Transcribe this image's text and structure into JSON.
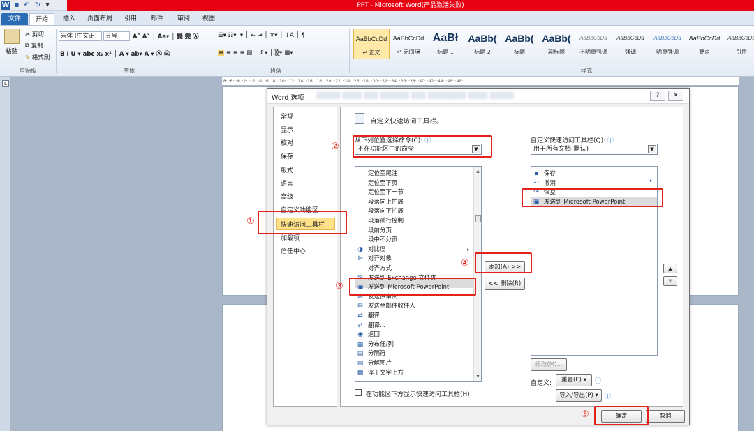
{
  "titlebar": {
    "title": "PPT - Microsoft Word(产品激活失败)",
    "app_icon": "W"
  },
  "tabs": [
    "文件",
    "开始",
    "插入",
    "页面布局",
    "引用",
    "邮件",
    "审阅",
    "视图"
  ],
  "ribbon": {
    "clipboard": {
      "paste": "粘贴",
      "cut": "剪切",
      "copy": "复制",
      "format_painter": "格式刷",
      "label": "剪贴板"
    },
    "font": {
      "name": "宋体 (中文正)",
      "size": "五号",
      "label": "字体"
    },
    "paragraph": {
      "label": "段落"
    },
    "styles": {
      "label": "样式",
      "items": [
        {
          "preview": "AaBbCcDd",
          "name": "↵ 正文"
        },
        {
          "preview": "AaBbCcDd",
          "name": "↵ 无间隔"
        },
        {
          "preview": "AaBł",
          "name": "标题 1"
        },
        {
          "preview": "AaBb(",
          "name": "标题 2"
        },
        {
          "preview": "AaBb(",
          "name": "标题"
        },
        {
          "preview": "AaBb(",
          "name": "副标题"
        },
        {
          "preview": "AaBbCcDd",
          "name": "不明显强调"
        },
        {
          "preview": "AaBbCcDd",
          "name": "强调"
        },
        {
          "preview": "AaBbCcDd",
          "name": "明显强调"
        },
        {
          "preview": "AaBbCcDd",
          "name": "要点"
        },
        {
          "preview": "AaBbCcDd",
          "name": "引用"
        }
      ]
    }
  },
  "dialog": {
    "title": "Word 选项",
    "help": "?",
    "close": "✕",
    "nav": [
      "常规",
      "显示",
      "校对",
      "保存",
      "版式",
      "语言",
      "高级",
      "自定义功能区",
      "快速访问工具栏",
      "加载项",
      "信任中心"
    ],
    "selected_nav": "快速访问工具栏",
    "heading": "自定义快速访问工具栏。",
    "choose_label": "从下列位置选择命令(C):",
    "choose_value": "不在功能区中的命令",
    "customize_label": "自定义快速访问工具栏(Q):",
    "customize_value": "用于所有文档(默认)",
    "commands": [
      {
        "label": "定位至尾注",
        "icon": ""
      },
      {
        "label": "定位至下页",
        "icon": ""
      },
      {
        "label": "定位至下一节",
        "icon": ""
      },
      {
        "label": "段落向上扩展",
        "icon": ""
      },
      {
        "label": "段落向下扩展",
        "icon": ""
      },
      {
        "label": "段落孤行控制",
        "icon": ""
      },
      {
        "label": "段前分页",
        "icon": ""
      },
      {
        "label": "段中不分页",
        "icon": ""
      },
      {
        "label": "对比度",
        "icon": "◑"
      },
      {
        "label": "对齐对象",
        "icon": "⊫"
      },
      {
        "label": "对齐方式",
        "icon": ""
      },
      {
        "label": "发送到 Exchange 文件夹",
        "icon": "✉"
      },
      {
        "label": "发送到 Microsoft PowerPoint",
        "icon": "▣"
      },
      {
        "label": "发送供审阅...",
        "icon": "✉"
      },
      {
        "label": "发送至邮件收件人",
        "icon": "✉"
      },
      {
        "label": "翻译",
        "icon": "⇄"
      },
      {
        "label": "翻译...",
        "icon": "⇄"
      },
      {
        "label": "返回",
        "icon": "◉"
      },
      {
        "label": "分布任/列",
        "icon": "▦"
      },
      {
        "label": "分隔符",
        "icon": "▤"
      },
      {
        "label": "分解图片",
        "icon": "▧"
      },
      {
        "label": "浮于文字上方",
        "icon": "▩"
      }
    ],
    "qat_items": [
      {
        "label": "保存",
        "icon": "▪"
      },
      {
        "label": "撤消",
        "icon": "↶"
      },
      {
        "label": "恢复",
        "icon": "↷"
      },
      {
        "label": "发送到 Microsoft PowerPoint",
        "icon": "▣"
      }
    ],
    "add_button": "添加(A) >>",
    "remove_button": "<< 删除(R)",
    "modify_button": "修改(M)...",
    "customize_text": "自定义:",
    "reset_button": "重置(E) ▾",
    "import_export_button": "导入/导出(P) ▾",
    "show_below_label": "在功能区下方显示快速访问工具栏(H)",
    "ok_button": "确定",
    "cancel_button": "取消"
  },
  "annotations": [
    "①",
    "②",
    "③",
    "④",
    "⑤"
  ],
  "colors": {
    "annotation": "#e32219",
    "title_bar": "#e60012",
    "selected_nav": "#ffe28a"
  }
}
